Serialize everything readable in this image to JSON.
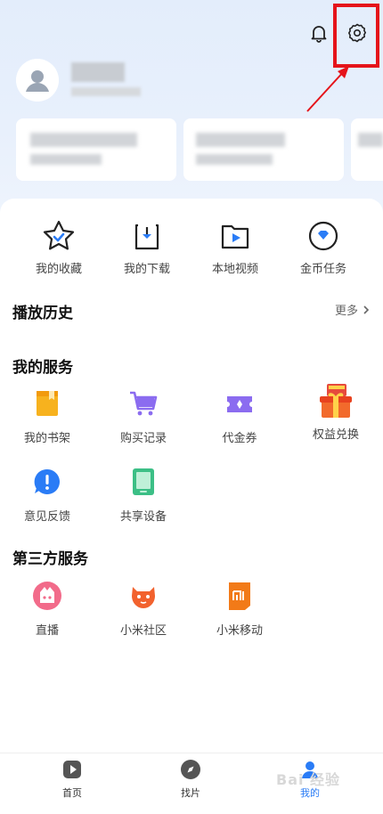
{
  "quick_actions": [
    {
      "label": "我的收藏",
      "icon": "star-icon"
    },
    {
      "label": "我的下载",
      "icon": "download-icon"
    },
    {
      "label": "本地视频",
      "icon": "folder-play-icon"
    },
    {
      "label": "金币任务",
      "icon": "coin-diamond-icon"
    }
  ],
  "history": {
    "title": "播放历史",
    "more_label": "更多"
  },
  "services": {
    "title": "我的服务",
    "items": [
      {
        "label": "我的书架",
        "icon": "bookshelf-icon"
      },
      {
        "label": "购买记录",
        "icon": "shopping-cart-icon"
      },
      {
        "label": "代金券",
        "icon": "coupon-icon"
      },
      {
        "label": "权益兑换",
        "icon": "gift-box-icon"
      },
      {
        "label": "意见反馈",
        "icon": "feedback-icon"
      },
      {
        "label": "共享设备",
        "icon": "tablet-icon"
      }
    ]
  },
  "third_party": {
    "title": "第三方服务",
    "items": [
      {
        "label": "直播",
        "icon": "live-icon"
      },
      {
        "label": "小米社区",
        "icon": "mi-community-icon"
      },
      {
        "label": "小米移动",
        "icon": "mi-mobile-icon"
      }
    ]
  },
  "tabs": [
    {
      "label": "首页",
      "icon": "play-square-icon"
    },
    {
      "label": "找片",
      "icon": "compass-icon"
    },
    {
      "label": "我的",
      "icon": "user-icon",
      "active": true
    }
  ],
  "watermark": "Bai 经验",
  "colors": {
    "accent": "#2a7cf6",
    "highlight": "#e5141a"
  }
}
